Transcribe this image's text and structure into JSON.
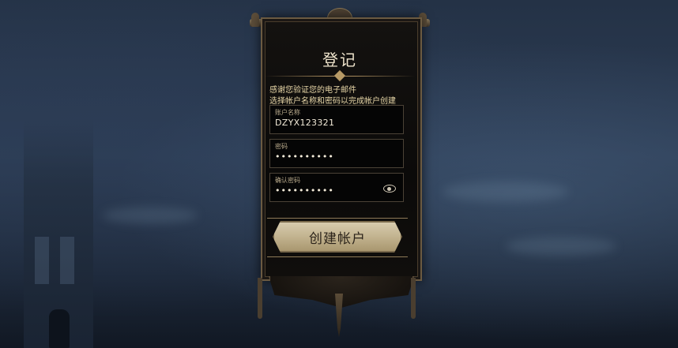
{
  "dialog": {
    "title": "登记",
    "message_line1": "感谢您验证您的电子邮件",
    "message_line2": "选择帐户名称和密码以完成帐户创建"
  },
  "form": {
    "account_name": {
      "label": "账户名称",
      "value": "DZYX123321"
    },
    "password": {
      "label": "密码",
      "value": "••••••••••"
    },
    "confirm_password": {
      "label": "确认密码",
      "value": "••••••••••"
    }
  },
  "buttons": {
    "create_account": "创建帐户"
  },
  "icons": {
    "show_password": "eye-icon"
  },
  "colors": {
    "accent_gold": "#a88b5c",
    "text_cream": "#e8d7a8",
    "field_bg": "#050505"
  }
}
